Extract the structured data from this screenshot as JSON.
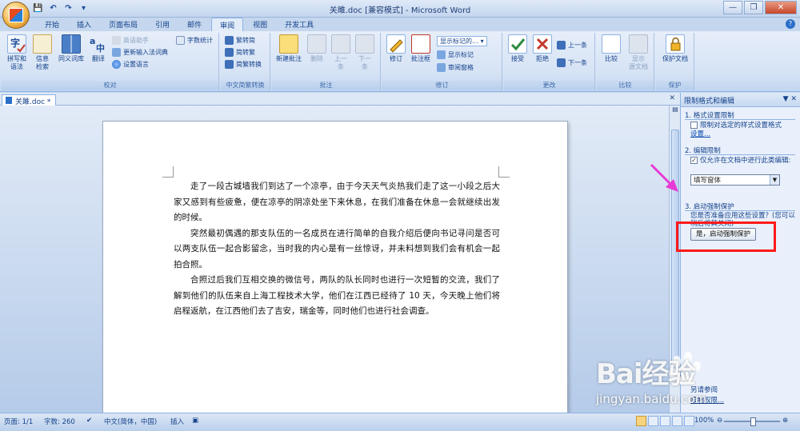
{
  "window": {
    "title": "关雎.doc [兼容模式] - Microsoft Word",
    "min": "—",
    "max": "❐",
    "close": "✕"
  },
  "qat": [
    "💾",
    "↶",
    "↷",
    "▾"
  ],
  "tabs": [
    "开始",
    "插入",
    "页面布局",
    "引用",
    "邮件",
    "审阅",
    "视图",
    "开发工具"
  ],
  "active_tab": "审阅",
  "ribbon": {
    "proofing": {
      "label": "校对",
      "spelling": "拼写和\n语法",
      "research": "信息\n检索",
      "thesaurus": "同义词库",
      "translate": "翻译",
      "translate_tip": "英语助手",
      "update_ime": "更新输入法词典",
      "set_language": "设置语言",
      "word_count": "字数统计"
    },
    "chinese": {
      "label": "中文简繁转换",
      "to_trad": "繁转简",
      "to_simp": "简转繁",
      "convert": "简繁转换"
    },
    "comments": {
      "label": "批注",
      "new": "新建批注",
      "delete": "删除",
      "prev": "上一\n条",
      "next": "下一\n条"
    },
    "tracking": {
      "label": "修订",
      "track": "修订",
      "balloons": "批注框",
      "display": "显示标记的...",
      "show_markup": "显示标记",
      "pane": "审阅窗格"
    },
    "changes": {
      "label": "更改",
      "accept": "接受",
      "reject": "拒绝",
      "prev": "上一条",
      "next": "下一条"
    },
    "compare": {
      "label": "比较",
      "compare": "比较",
      "show_source": "显示\n源文档"
    },
    "protect": {
      "label": "保护",
      "protect_doc": "保护文档"
    }
  },
  "document": {
    "tab_name": "关雎.doc *",
    "paragraphs": [
      "走了一段古城墙我们到达了一个凉亭，由于今天天气炎热我们走了这一小段之后大家又感到有些疲惫，便在凉亭的阴凉处坐下来休息，在我们准备在休息一会就继续出发的时候。",
      "突然最初偶遇的那支队伍的一名成员在进行简单的自我介绍后便向书记寻问是否可以两支队伍一起合影留念，当时我的内心是有一丝惊讶，并未料想到我们会有机会一起拍合照。",
      "合照过后我们互相交换的微信号，两队的队长同时也进行一次短暂的交流，我们了解到他们的队伍来自上海工程技术大学，他们在江西已经待了 10 天，今天晚上他们将启程返航，在江西他们去了吉安，瑞金等，同时他们也进行社会调查。"
    ]
  },
  "pane": {
    "title": "限制格式和编辑",
    "s1_title": "1. 格式设置限制",
    "s1_check": "限制对选定的样式设置格式",
    "s1_link": "设置...",
    "s2_title": "2. 编辑限制",
    "s2_check": "仅允许在文档中进行此类编辑:",
    "s2_select": "填写窗体",
    "s3_title": "3. 启动强制保护",
    "s3_question": "您是否准备应用这些设置？(您可以稍后将其关闭)",
    "enforce_button": "是，启动强制保护",
    "bottom_label": "另请参阅",
    "bottom_link": "限制权限..."
  },
  "status": {
    "page": "页面: 1/1",
    "words": "字数: 260",
    "language": "中文(简体，中国)",
    "insert": "插入",
    "zoom": "100%"
  },
  "watermark": {
    "logo": "Bai经验",
    "url": "jingyan.baidu.com"
  }
}
